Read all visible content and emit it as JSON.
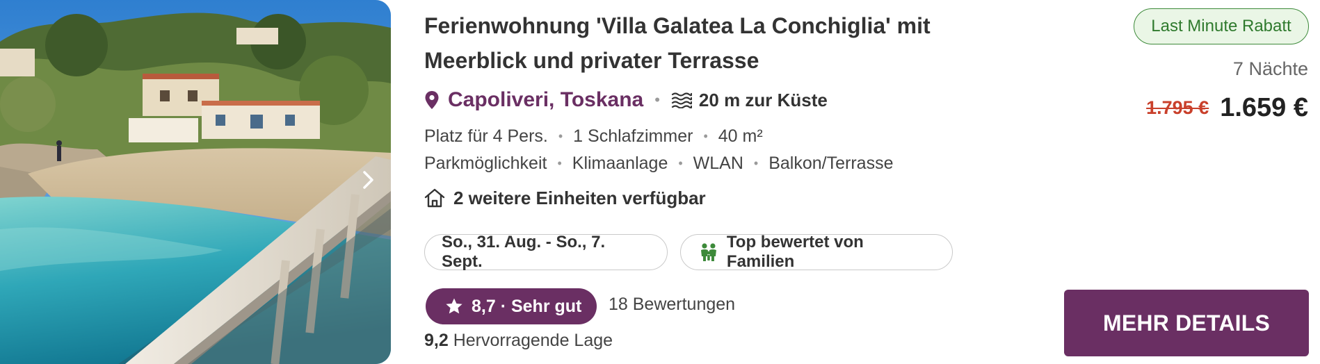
{
  "listing": {
    "title_line1": "Ferienwohnung 'Villa Galatea La Conchiglia' mit",
    "title_line2": "Meerblick und privater Terrasse",
    "location": "Capoliveri, Toskana",
    "distance_to_coast": "20 m zur Küste",
    "facts": [
      "Platz für 4 Pers.",
      "1 Schlafzimmer",
      "40 m²"
    ],
    "amenities": [
      "Parkmöglichkeit",
      "Klimaanlage",
      "WLAN",
      "Balkon/Terrasse"
    ],
    "more_units": "2 weitere Einheiten verfügbar",
    "dates": "So., 31. Aug. - So., 7. Sept.",
    "family_badge": "Top bewertet von Familien",
    "rating": "8,7 · Sehr gut",
    "reviews": "18 Bewertungen",
    "location_score_value": "9,2",
    "location_score_label": "Hervorragende Lage"
  },
  "pricing": {
    "badge": "Last Minute Rabatt",
    "nights": "7 Nächte",
    "old_price": "1.795 €",
    "new_price": "1.659 €",
    "cta": "MEHR DETAILS"
  },
  "icons": {
    "location": "map-pin-icon",
    "coast": "waves-icon",
    "units": "house-icon",
    "family": "family-icon",
    "rating": "star-icon",
    "gallery_next": "chevron-right-icon"
  },
  "colors": {
    "brand_purple": "#6a2f63",
    "discount_red": "#c9402b",
    "badge_green": "#2f7a2d",
    "badge_green_bg": "#eaf6e6"
  }
}
